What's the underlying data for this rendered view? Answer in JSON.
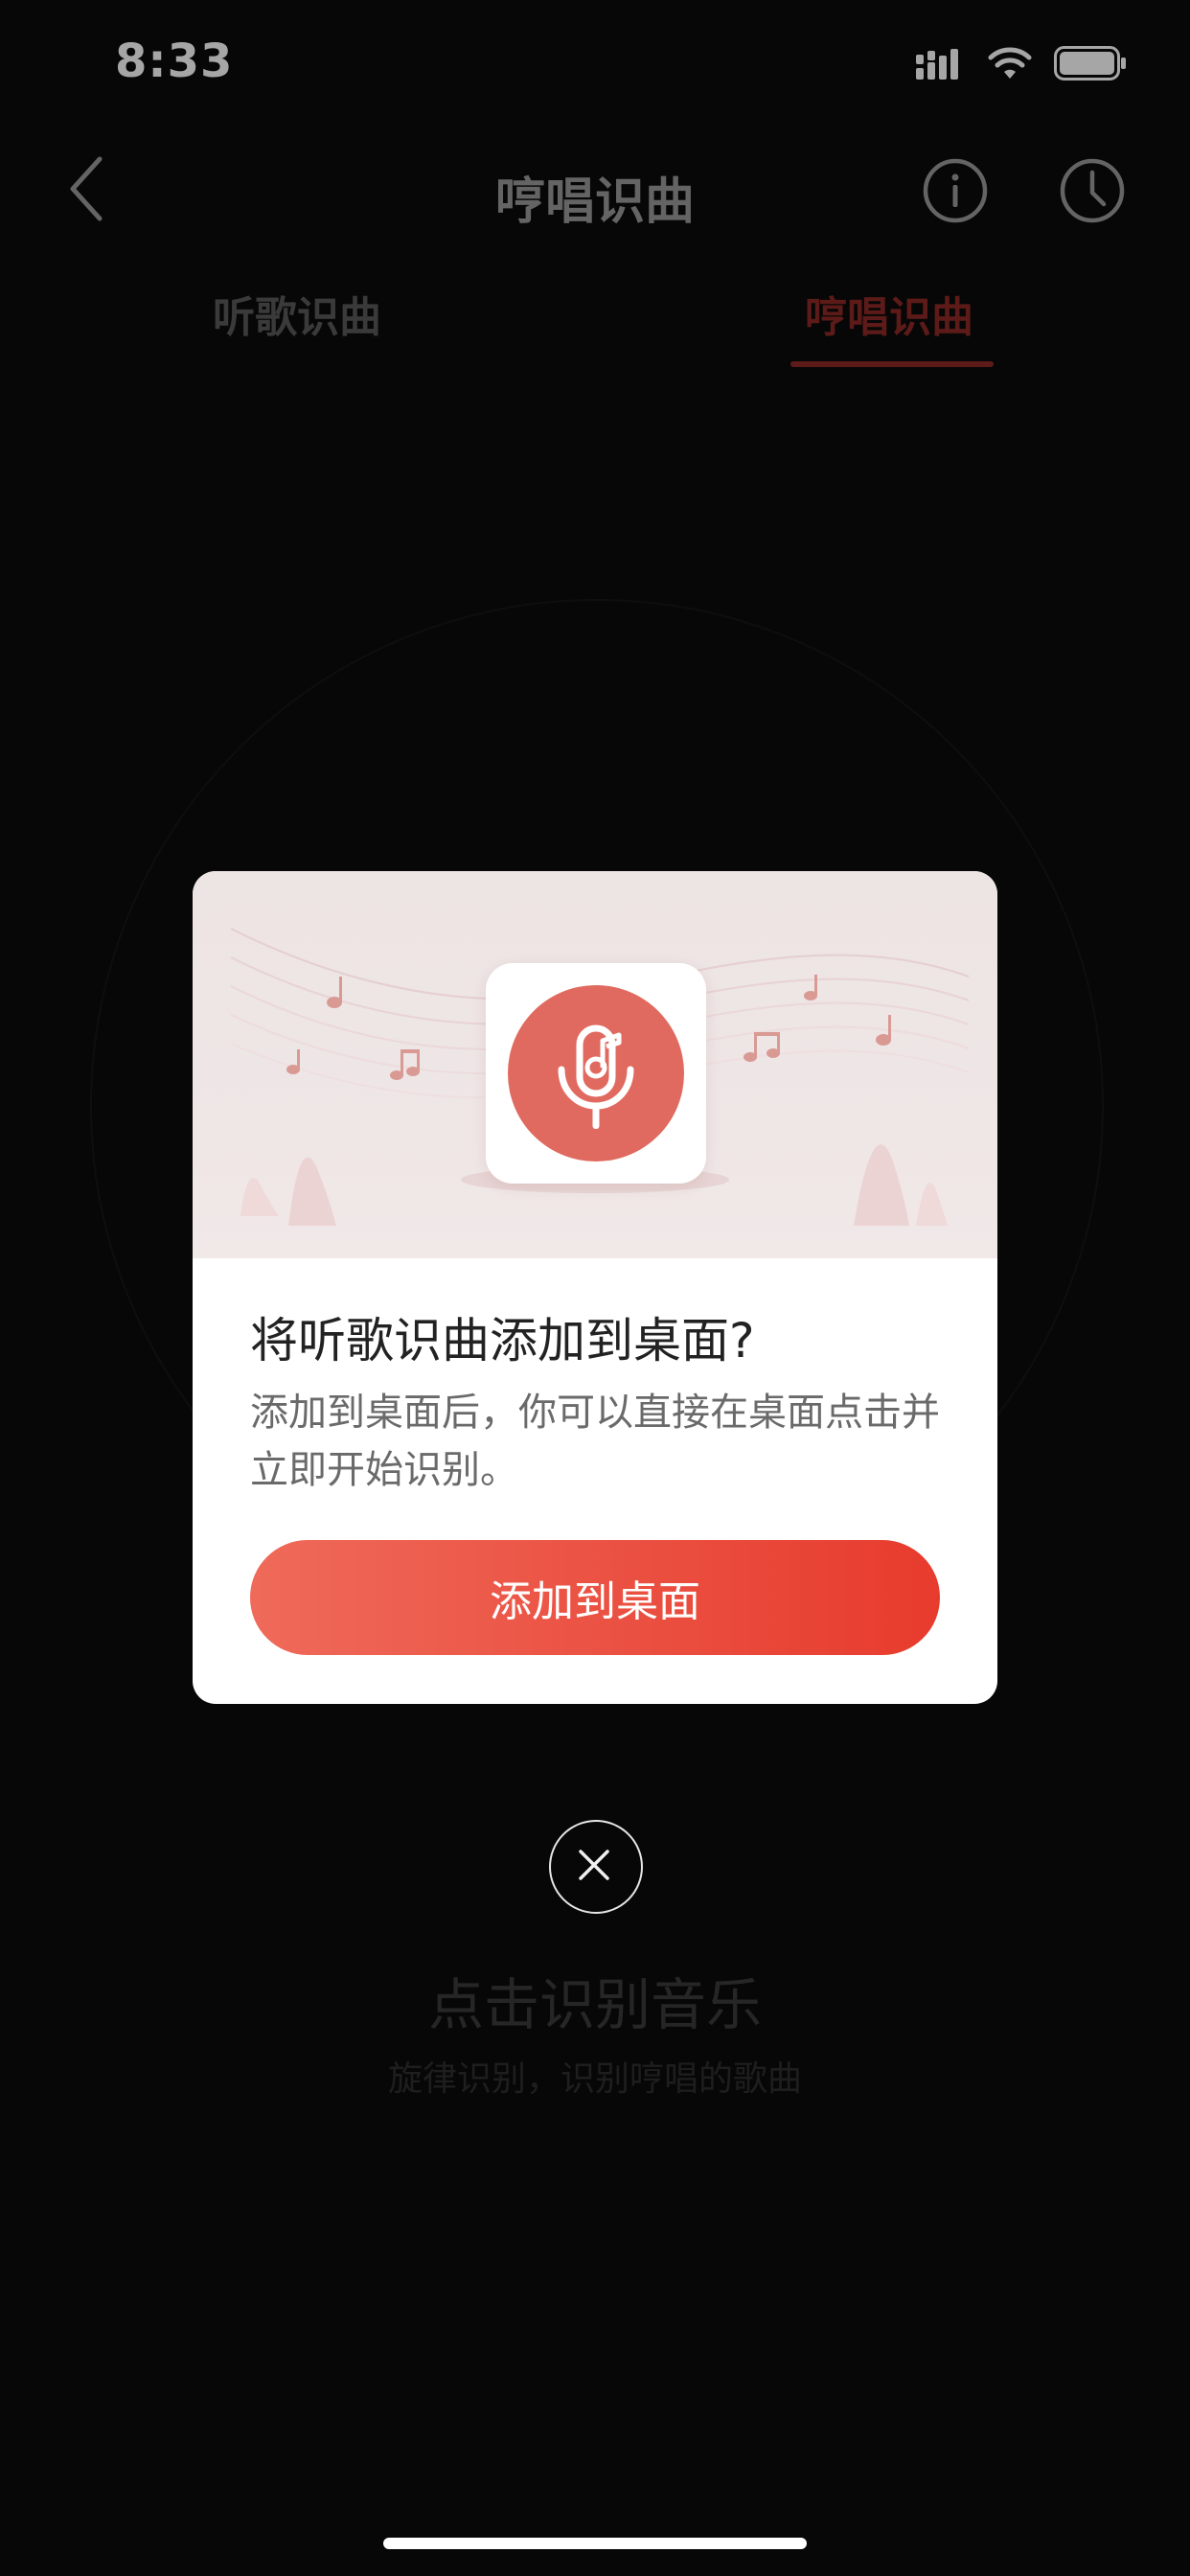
{
  "status_bar": {
    "time": "8:33"
  },
  "nav": {
    "title": "哼唱识曲"
  },
  "tabs": [
    {
      "label": "听歌识曲",
      "selected": false
    },
    {
      "label": "哼唱识曲",
      "selected": true
    }
  ],
  "main": {
    "action_text": "点击识别音乐",
    "hint_text": "旋律识别，识别哼唱的歌曲"
  },
  "dialog": {
    "title": "将听歌识曲添加到桌面?",
    "description": "添加到桌面后，你可以直接在桌面点击并立即开始识别。",
    "button_label": "添加到桌面"
  },
  "colors": {
    "accent": "#e73b2d",
    "tab_active": "#8e2a25",
    "icon_red": "#e06a5f"
  },
  "icons": [
    "back-icon",
    "info-icon",
    "history-icon",
    "microphone-music-icon",
    "close-icon"
  ]
}
